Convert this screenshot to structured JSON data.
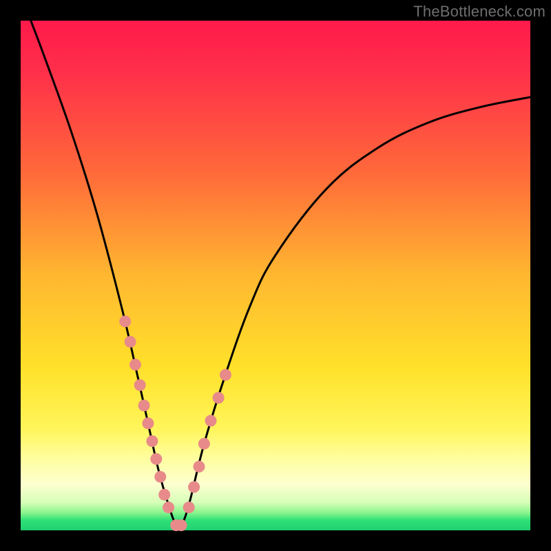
{
  "watermark": "TheBottleneck.com",
  "chart_data": {
    "type": "line",
    "title": "",
    "xlabel": "",
    "ylabel": "",
    "xlim": [
      0,
      100
    ],
    "ylim": [
      0,
      100
    ],
    "grid": false,
    "legend": false,
    "note": "V-shaped bottleneck curve over red→green vertical gradient; no axis ticks or labels shown.",
    "series": [
      {
        "name": "bottleneck-curve",
        "x": [
          2,
          5,
          10,
          15,
          20,
          23,
          25,
          27,
          29,
          30.5,
          31.5,
          33,
          36,
          40,
          45,
          50,
          60,
          70,
          80,
          90,
          100
        ],
        "y": [
          100,
          92,
          78,
          62,
          43,
          30,
          21,
          12,
          5,
          1,
          1,
          5,
          17,
          30,
          44,
          54,
          67,
          75,
          80,
          83,
          85
        ]
      }
    ],
    "markers": {
      "name": "highlight-dots",
      "color": "#e88a8a",
      "x": [
        20.5,
        21.5,
        22.5,
        23.4,
        24.2,
        25.0,
        25.8,
        26.6,
        27.4,
        28.2,
        29.0,
        30.5,
        31.5,
        33.0,
        34.0,
        35.0,
        36.0,
        37.3,
        38.8,
        40.2
      ],
      "y": [
        41.0,
        37.0,
        32.5,
        28.5,
        24.5,
        21.0,
        17.5,
        14.0,
        10.5,
        7.0,
        4.5,
        1.0,
        1.0,
        4.5,
        8.5,
        12.5,
        17.0,
        21.5,
        26.0,
        30.5
      ]
    }
  }
}
